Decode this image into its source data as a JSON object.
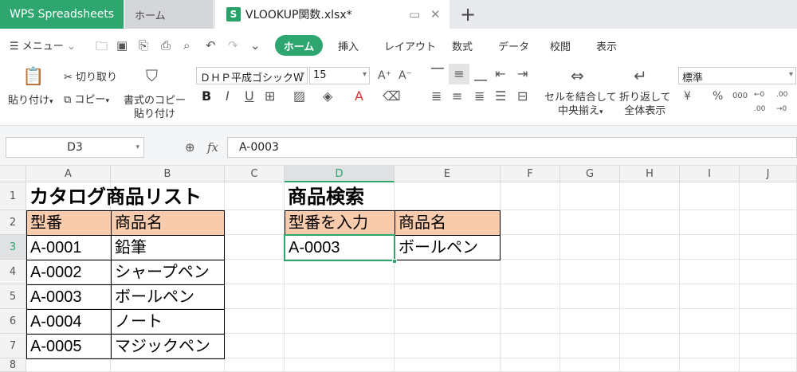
{
  "tabs": {
    "app": "WPS Spreadsheets",
    "home": "ホーム",
    "doc": "VLOOKUP関数.xlsx*",
    "doc_icon": "S"
  },
  "quick": {
    "menu_label": "メニュー",
    "ribbon_tabs": [
      "挿入",
      "レイアウト",
      "数式",
      "データ",
      "校閲",
      "表示"
    ],
    "active_tab": "ホーム"
  },
  "ribbon": {
    "paste": "貼り付け",
    "cut": "切り取り",
    "copy": "コピー",
    "format_painter_1": "書式のコピー",
    "format_painter_2": "貼り付け",
    "font": "ＤＨＰ平成ゴシックW",
    "size": "15",
    "merge_1": "セルを結合して",
    "merge_2": "中央揃え",
    "wrap_1": "折り返して",
    "wrap_2": "全体表示",
    "number_format": "標準"
  },
  "formula_bar": {
    "name_box": "D3",
    "fx": "fx",
    "value": "A-0003"
  },
  "columns": [
    "A",
    "B",
    "C",
    "D",
    "E",
    "F",
    "G",
    "H",
    "I",
    "J"
  ],
  "rows": [
    "1",
    "2",
    "3",
    "4",
    "5",
    "6",
    "7",
    "8"
  ],
  "sheet": {
    "a1": "カタログ商品リスト",
    "a2": "型番",
    "b2": "商品名",
    "a3": "A-0001",
    "b3": "鉛筆",
    "a4": "A-0002",
    "b4": "シャープペン",
    "a5": "A-0003",
    "b5": "ボールペン",
    "a6": "A-0004",
    "b6": "ノート",
    "a7": "A-0005",
    "b7": "マジックペン",
    "d1": "商品検索",
    "d2": "型番を入力",
    "e2": "商品名",
    "d3": "A-0003",
    "e3": "ボールペン"
  },
  "colors": {
    "accent": "#2ea66f",
    "header_fill": "#f8cbad"
  }
}
